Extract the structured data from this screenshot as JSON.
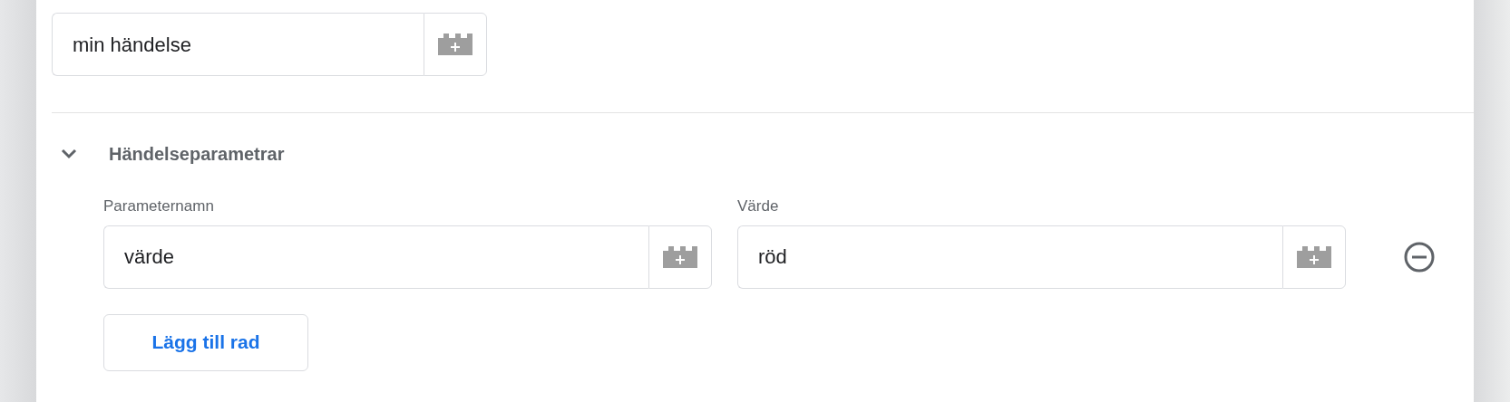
{
  "event_name": {
    "value": "min händelse"
  },
  "section": {
    "title": "Händelseparametrar",
    "expanded": true
  },
  "columns": [
    "Parameternamn",
    "Värde"
  ],
  "rows": [
    {
      "name": "värde",
      "value": "röd"
    }
  ],
  "add_button": "Lägg till rad"
}
